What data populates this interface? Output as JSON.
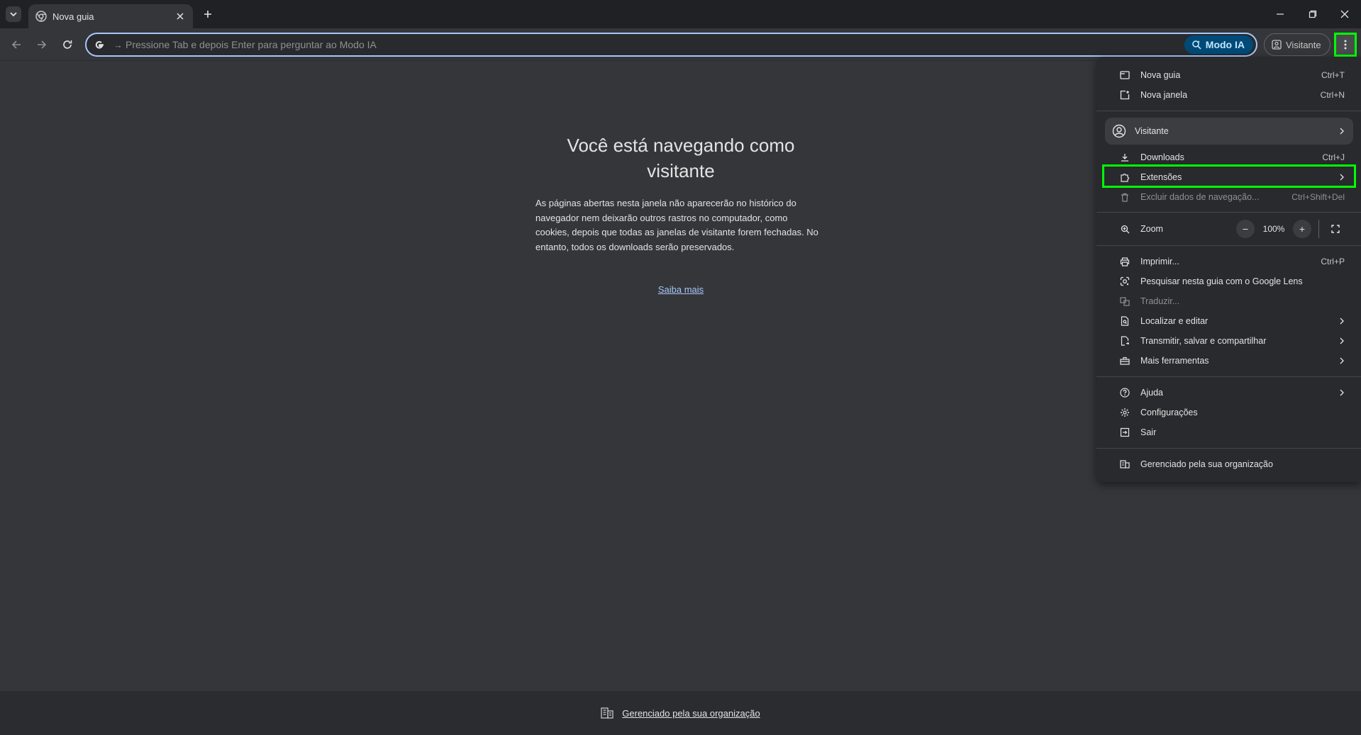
{
  "tab": {
    "title": "Nova guia"
  },
  "omnibox": {
    "arrow": "→",
    "placeholder": "Pressione Tab e depois Enter para perguntar ao Modo IA",
    "ai_mode_label": "Modo IA"
  },
  "profile_button": {
    "label": "Visitante"
  },
  "page": {
    "heading": "Você está navegando como visitante",
    "description": "As páginas abertas nesta janela não aparecerão no histórico do navegador nem deixarão outros rastros no computador, como cookies, depois que todas as janelas de visitante forem fechadas. No entanto, todos os downloads serão preservados.",
    "learn_more": "Saiba mais",
    "managed_footer": "Gerenciado pela sua organização"
  },
  "menu": {
    "new_tab": {
      "label": "Nova guia",
      "shortcut": "Ctrl+T"
    },
    "new_window": {
      "label": "Nova janela",
      "shortcut": "Ctrl+N"
    },
    "profile": {
      "label": "Visitante"
    },
    "downloads": {
      "label": "Downloads",
      "shortcut": "Ctrl+J"
    },
    "extensions": {
      "label": "Extensões"
    },
    "clear_data": {
      "label": "Excluir dados de navegação...",
      "shortcut": "Ctrl+Shift+Del"
    },
    "zoom": {
      "label": "Zoom",
      "minus": "−",
      "value": "100%",
      "plus": "+"
    },
    "print": {
      "label": "Imprimir...",
      "shortcut": "Ctrl+P"
    },
    "lens": {
      "label": "Pesquisar nesta guia com o Google Lens"
    },
    "translate": {
      "label": "Traduzir..."
    },
    "find_edit": {
      "label": "Localizar e editar"
    },
    "cast_save_share": {
      "label": "Transmitir, salvar e compartilhar"
    },
    "more_tools": {
      "label": "Mais ferramentas"
    },
    "help": {
      "label": "Ajuda"
    },
    "settings": {
      "label": "Configurações"
    },
    "exit": {
      "label": "Sair"
    },
    "managed": {
      "label": "Gerenciado pela sua organização"
    }
  },
  "colors": {
    "highlight": "#00ff00",
    "link": "#a8c7fa",
    "ai_button": "#004a77"
  }
}
